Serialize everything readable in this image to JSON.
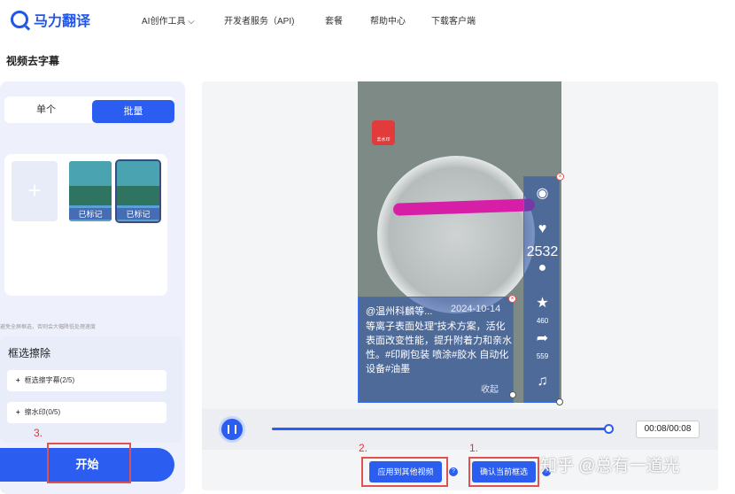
{
  "header": {
    "logo_text": "马力翻译",
    "nav": [
      "AI创作工具",
      "开发者服务（API)",
      "套餐",
      "帮助中心",
      "下载客户端"
    ]
  },
  "page_title": "视频去字幕",
  "left_panel": {
    "mode_single": "单个",
    "mode_batch": "批量",
    "add_icon": "+",
    "thumbnails": [
      {
        "label": "已标记"
      },
      {
        "label": "已标记"
      }
    ],
    "hint": "避免全屏框选，否则会大幅降低处理速度",
    "erase": {
      "title": "框选擦除",
      "options": [
        "框选擦字幕(2/5)",
        "擦水印(0/5)"
      ]
    },
    "start_label": "开始"
  },
  "video": {
    "badge_text": "去水印",
    "author": "@温州科麟等...",
    "date": "2024-10-14",
    "description": "等离子表面处理”技术方案，活化表面改变性能，提升附着力和亲水性。#印刷包装 喷涂#胶水 自动化设备#油墨",
    "collapse": "收起",
    "side_counts": {
      "likes": "2532",
      "stars": "460",
      "shares": "559"
    }
  },
  "controls": {
    "time": "00:08/00:08",
    "progress": 1.0,
    "apply_label": "应用到其他视频",
    "confirm_label": "确认当前框选"
  },
  "annotations": {
    "step1": "1.",
    "step2": "2.",
    "step3": "3."
  },
  "watermark": "知乎 @总有一道光",
  "colors": {
    "accent": "#2a5df0",
    "annotation": "#e05252"
  }
}
